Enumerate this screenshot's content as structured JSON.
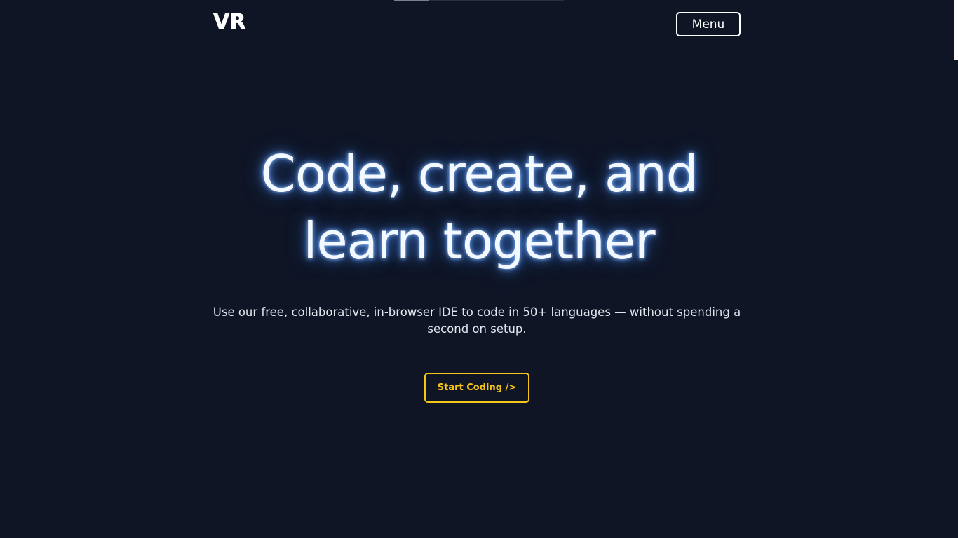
{
  "header": {
    "logo_text": "VR",
    "menu_label": "Menu"
  },
  "hero": {
    "title_line1": "Code, create, and",
    "title_line2": "learn together",
    "subtitle": "Use our free, collaborative, in-browser IDE to code in 50+ languages — without spending a second on setup.",
    "cta_label": "Start Coding />"
  },
  "colors": {
    "background": "#0f1525",
    "accent": "#f5c518",
    "title_glow": "#5096ff",
    "text": "#ffffff"
  }
}
